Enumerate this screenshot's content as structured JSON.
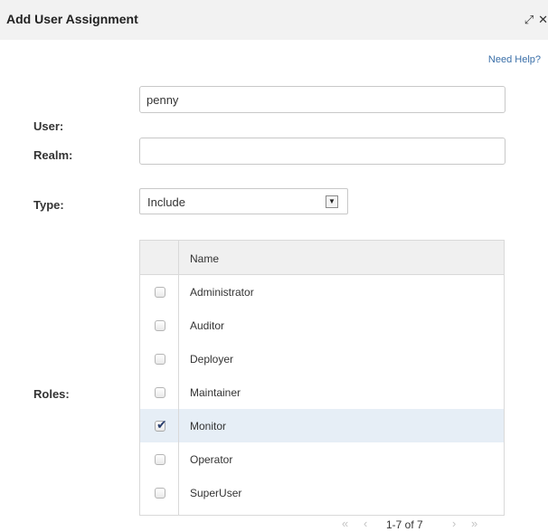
{
  "dialog": {
    "title": "Add User Assignment",
    "icons": {
      "resize": "resize-icon",
      "close": "close-icon"
    },
    "help_link": "Need Help?"
  },
  "form": {
    "user": {
      "label": "User:",
      "value": "penny"
    },
    "realm": {
      "label": "Realm:",
      "value": ""
    },
    "type": {
      "label": "Type:",
      "selected": "Include"
    },
    "roles": {
      "label": "Roles:",
      "column_header": "Name",
      "items": [
        {
          "name": "Administrator",
          "checked": false
        },
        {
          "name": "Auditor",
          "checked": false
        },
        {
          "name": "Deployer",
          "checked": false
        },
        {
          "name": "Maintainer",
          "checked": false
        },
        {
          "name": "Monitor",
          "checked": true
        },
        {
          "name": "Operator",
          "checked": false
        },
        {
          "name": "SuperUser",
          "checked": false
        }
      ]
    }
  },
  "pagination": {
    "summary": "1-7 of 7",
    "first": "«",
    "prev": "‹",
    "next": "›",
    "last": "»"
  },
  "colors": {
    "titlebar": "#f2f2f2",
    "link": "#3a6fa8",
    "selected_row": "#e6eef6",
    "check": "#2a3f6e"
  }
}
